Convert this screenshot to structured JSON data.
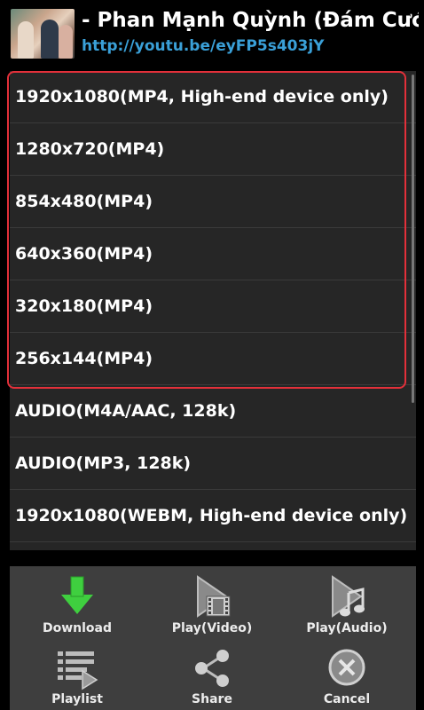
{
  "header": {
    "title": "- Phan Mạnh Quỳnh (Đám Cưới Ve",
    "url": "http://youtu.be/eyFP5s403jY"
  },
  "formats": [
    {
      "label": "1920x1080(MP4, High-end device only)"
    },
    {
      "label": "1280x720(MP4)"
    },
    {
      "label": "854x480(MP4)"
    },
    {
      "label": "640x360(MP4)"
    },
    {
      "label": "320x180(MP4)"
    },
    {
      "label": "256x144(MP4)"
    },
    {
      "label": "AUDIO(M4A/AAC, 128k)"
    },
    {
      "label": "AUDIO(MP3, 128k)"
    },
    {
      "label": "1920x1080(WEBM, High-end device only)"
    }
  ],
  "actions": {
    "download": "Download",
    "play_video": "Play(Video)",
    "play_audio": "Play(Audio)",
    "playlist": "Playlist",
    "share": "Share",
    "cancel": "Cancel"
  },
  "colors": {
    "highlight": "#e3303a",
    "link": "#3aa0d8",
    "download_arrow": "#3fcf3f"
  }
}
